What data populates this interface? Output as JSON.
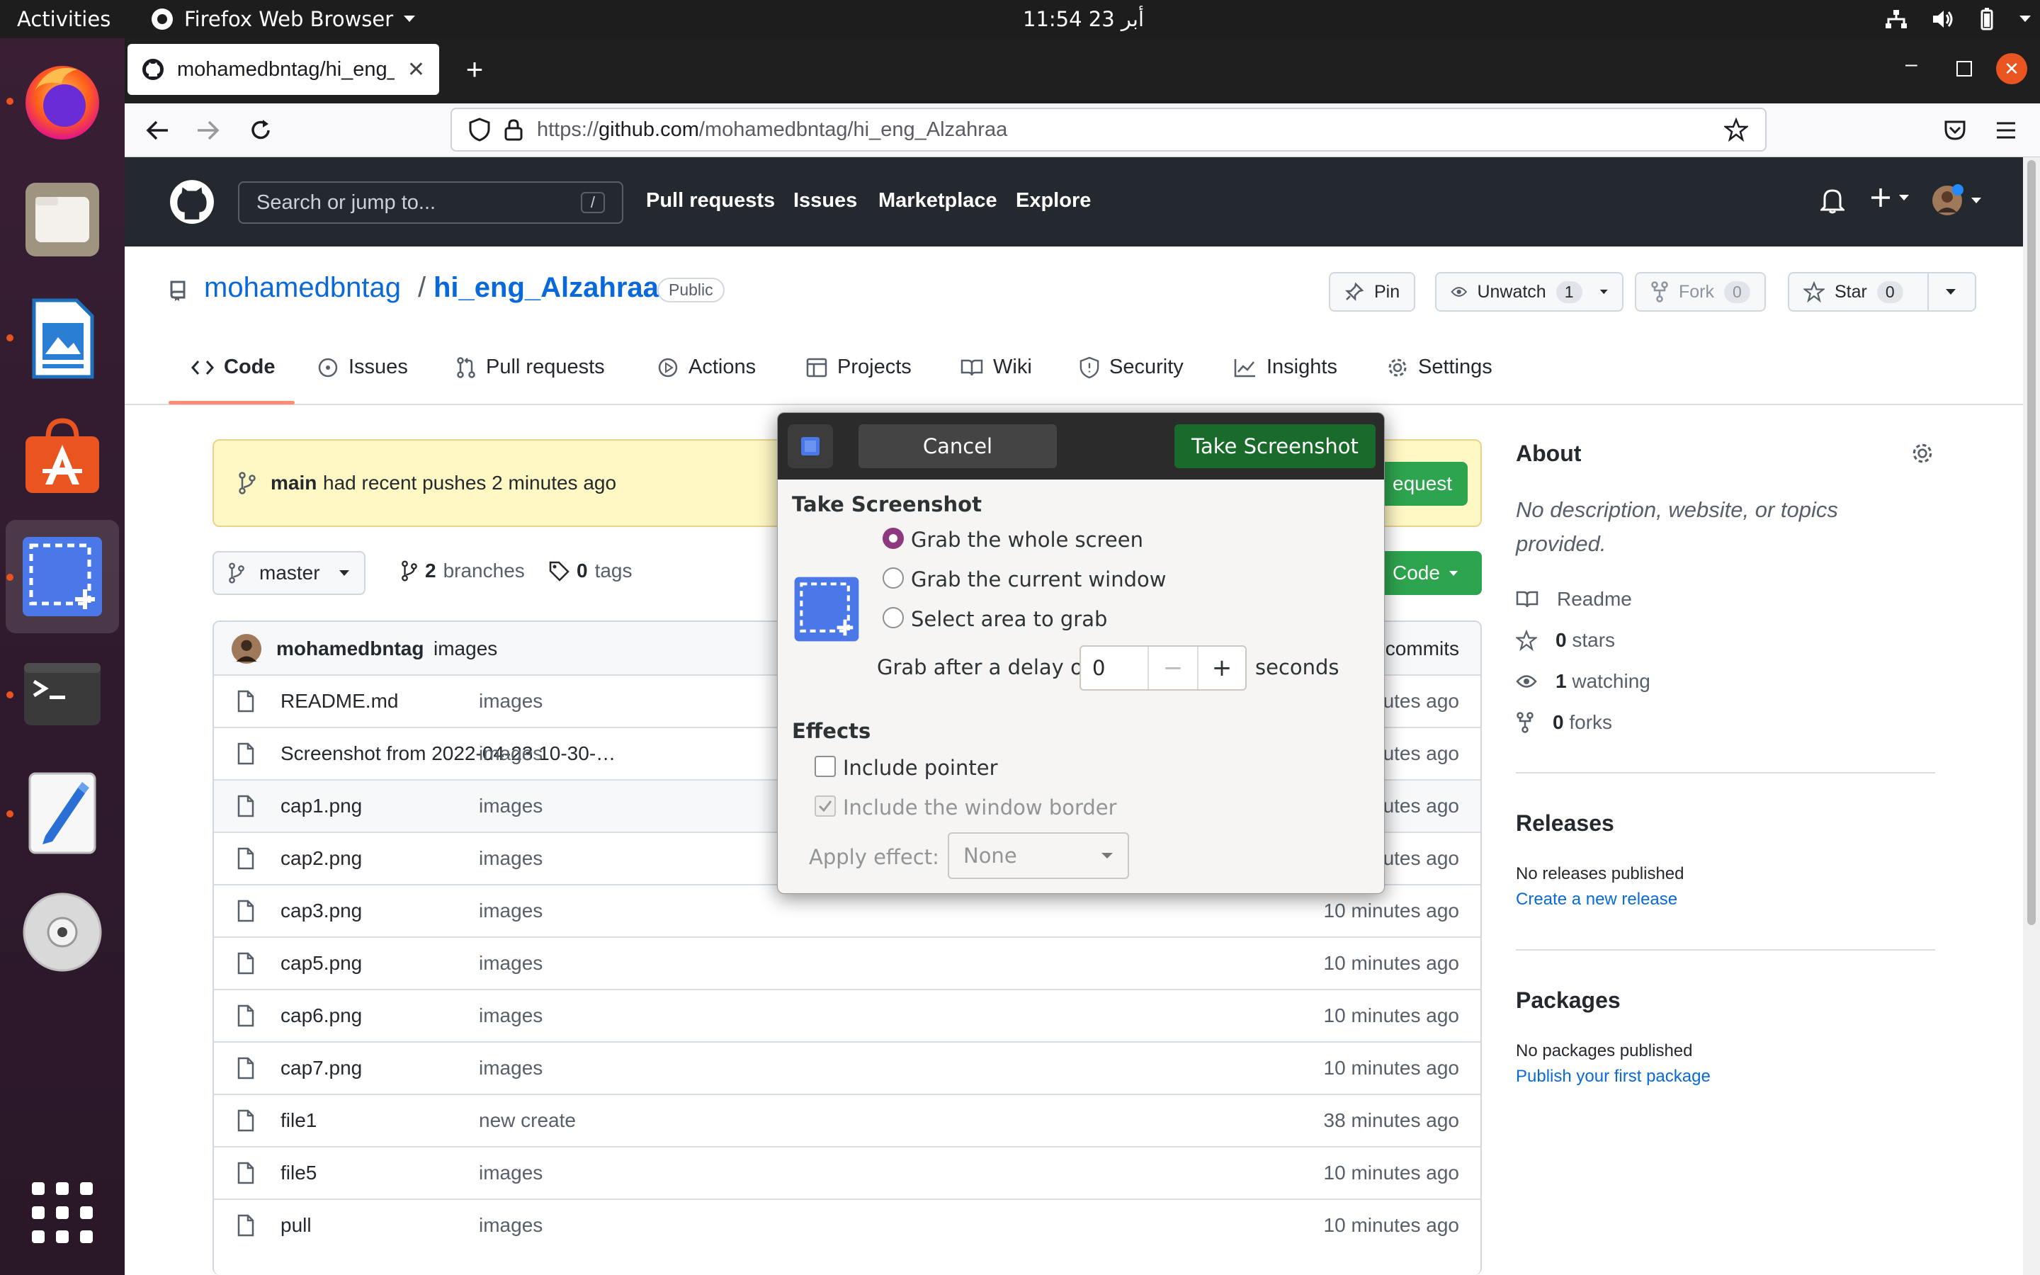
{
  "topbar": {
    "activities": "Activities",
    "app_name": "Firefox Web Browser",
    "clock": "11:54  23 أبر"
  },
  "browser": {
    "tab_title": "mohamedbntag/hi_eng_Alzahraa",
    "url_scheme": "https://",
    "url_host": "github.com",
    "url_path": "/mohamedbntag/hi_eng_Alzahraa"
  },
  "github": {
    "search_placeholder": "Search or jump to...",
    "search_key": "/",
    "nav": [
      "Pull requests",
      "Issues",
      "Marketplace",
      "Explore"
    ],
    "owner": "mohamedbntag",
    "separator": "/",
    "repo": "hi_eng_Alzahraa",
    "visibility": "Public",
    "actions": {
      "pin": "Pin",
      "unwatch": "Unwatch",
      "unwatch_count": "1",
      "fork": "Fork",
      "fork_count": "0",
      "star": "Star",
      "star_count": "0"
    },
    "tabs": [
      "Code",
      "Issues",
      "Pull requests",
      "Actions",
      "Projects",
      "Wiki",
      "Security",
      "Insights",
      "Settings"
    ],
    "banner": {
      "branch": "main",
      "text": "had recent pushes 2 minutes ago",
      "button": "equest"
    },
    "branch_bar": {
      "branch": "master",
      "branches_count": "2",
      "branches_label": "branches",
      "tags_count": "0",
      "tags_label": "tags",
      "code_button": "Code"
    },
    "commit": {
      "author": "mohamedbntag",
      "message": "images",
      "commits_label": "commits"
    },
    "files": [
      {
        "name": "README.md",
        "message": "images",
        "time": "utes ago"
      },
      {
        "name": "Screenshot from 2022-04-23 10-30-…",
        "message": "images",
        "time": "utes ago"
      },
      {
        "name": "cap1.png",
        "message": "images",
        "time": "utes ago"
      },
      {
        "name": "cap2.png",
        "message": "images",
        "time": "utes ago"
      },
      {
        "name": "cap3.png",
        "message": "images",
        "time": "10 minutes ago"
      },
      {
        "name": "cap5.png",
        "message": "images",
        "time": "10 minutes ago"
      },
      {
        "name": "cap6.png",
        "message": "images",
        "time": "10 minutes ago"
      },
      {
        "name": "cap7.png",
        "message": "images",
        "time": "10 minutes ago"
      },
      {
        "name": "file1",
        "message": "new create",
        "time": "38 minutes ago"
      },
      {
        "name": "file5",
        "message": "images",
        "time": "10 minutes ago"
      },
      {
        "name": "pull",
        "message": "images",
        "time": "10 minutes ago"
      }
    ],
    "about": {
      "title": "About",
      "description": "No description, website, or topics provided.",
      "readme": "Readme",
      "stars_count": "0",
      "stars_label": "stars",
      "watching_count": "1",
      "watching_label": "watching",
      "forks_count": "0",
      "forks_label": "forks"
    },
    "releases": {
      "title": "Releases",
      "none": "No releases published",
      "link": "Create a new release"
    },
    "packages": {
      "title": "Packages",
      "none": "No packages published",
      "link": "Publish your first package"
    }
  },
  "dialog": {
    "cancel": "Cancel",
    "take_screenshot": "Take Screenshot",
    "section_take": "Take Screenshot",
    "options": [
      "Grab the whole screen",
      "Grab the current window",
      "Select area to grab"
    ],
    "selected_option": "Grab the whole screen",
    "delay_label": "Grab after a delay of",
    "delay_value": "0",
    "delay_unit": "seconds",
    "section_effects": "Effects",
    "include_pointer": "Include pointer",
    "include_border": "Include the window border",
    "apply_effect_label": "Apply effect:",
    "apply_effect_value": "None"
  },
  "colors": {
    "github_header": "#24292f",
    "link_blue": "#0969da",
    "primary_green": "#2da44e",
    "dialog_green": "#1a6b2b",
    "radio_selected": "#8d3a80",
    "ubuntu_orange": "#e95420"
  }
}
